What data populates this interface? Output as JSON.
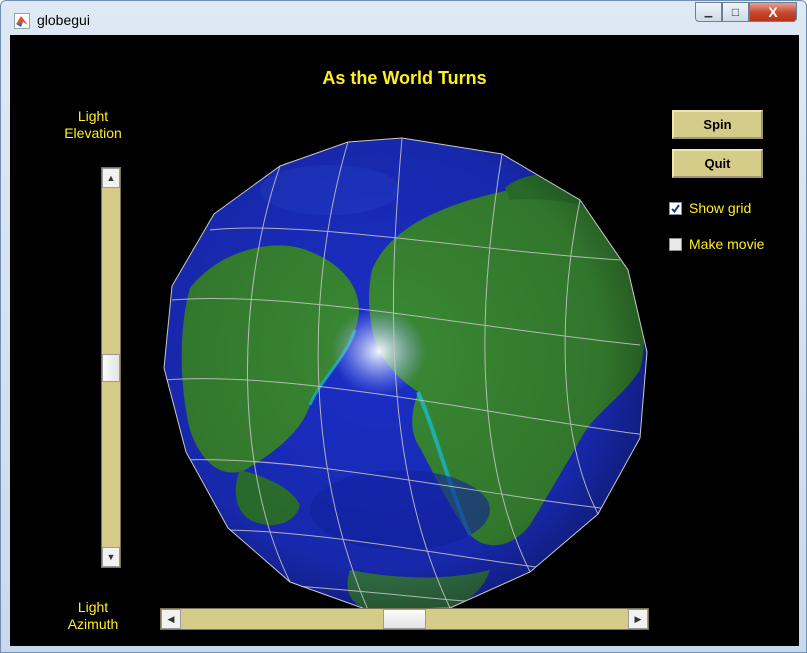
{
  "window": {
    "title": "globegui",
    "minimize_glyph": "▁",
    "maximize_glyph": "□",
    "close_glyph": "X"
  },
  "figure": {
    "title": "As the World Turns"
  },
  "light_elevation": {
    "label_line1": "Light",
    "label_line2": "Elevation",
    "value_fraction": 0.5,
    "up_glyph": "▲",
    "down_glyph": "▼"
  },
  "light_azimuth": {
    "label_line1": "Light",
    "label_line2": "Azimuth",
    "value_fraction": 0.5,
    "left_glyph": "◀",
    "right_glyph": "▶"
  },
  "controls": {
    "spin_label": "Spin",
    "quit_label": "Quit",
    "show_grid": {
      "label": "Show grid",
      "checked": true
    },
    "make_movie": {
      "label": "Make movie",
      "checked": false
    }
  },
  "icons": {
    "app": "matlab-logo-icon",
    "globe": "earth-globe-icon"
  },
  "colors": {
    "label_yellow": "#ffee22",
    "scrollbar_tan": "#d6cc89",
    "background": "#000000",
    "ocean": "#1b2fc9",
    "land": "#3a8a34",
    "grid": "#c8c8c8"
  }
}
